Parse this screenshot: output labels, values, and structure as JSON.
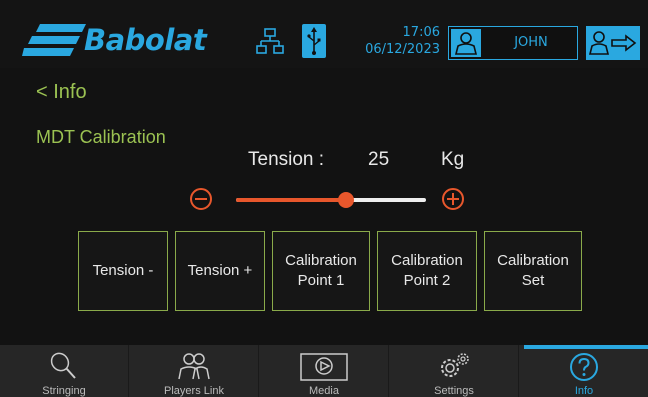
{
  "header": {
    "brand": "Babolat",
    "time": "17:06",
    "date": "06/12/2023",
    "user_name": "JOHN",
    "accent_color": "#2aa8e0"
  },
  "page": {
    "back_label": "< Info",
    "section_title": "MDT Calibration",
    "accent_color": "#9bc252"
  },
  "tension": {
    "label": "Tension :",
    "value": "25",
    "unit": "Kg",
    "slider_level": 0.58,
    "slider_color": "#e8572c"
  },
  "buttons": [
    {
      "label_line1": "Tension -",
      "label_line2": ""
    },
    {
      "label_line1": "Tension +",
      "label_line2": ""
    },
    {
      "label_line1": "Calibration",
      "label_line2": "Point 1"
    },
    {
      "label_line1": "Calibration",
      "label_line2": "Point 2"
    },
    {
      "label_line1": "Calibration",
      "label_line2": "Set"
    }
  ],
  "nav": {
    "items": [
      {
        "label": "Stringing",
        "icon": "racket-icon"
      },
      {
        "label": "Players Link",
        "icon": "players-icon"
      },
      {
        "label": "Media",
        "icon": "play-icon"
      },
      {
        "label": "Settings",
        "icon": "gears-icon"
      },
      {
        "label": "Info",
        "icon": "help-icon"
      }
    ],
    "active": "Info"
  }
}
